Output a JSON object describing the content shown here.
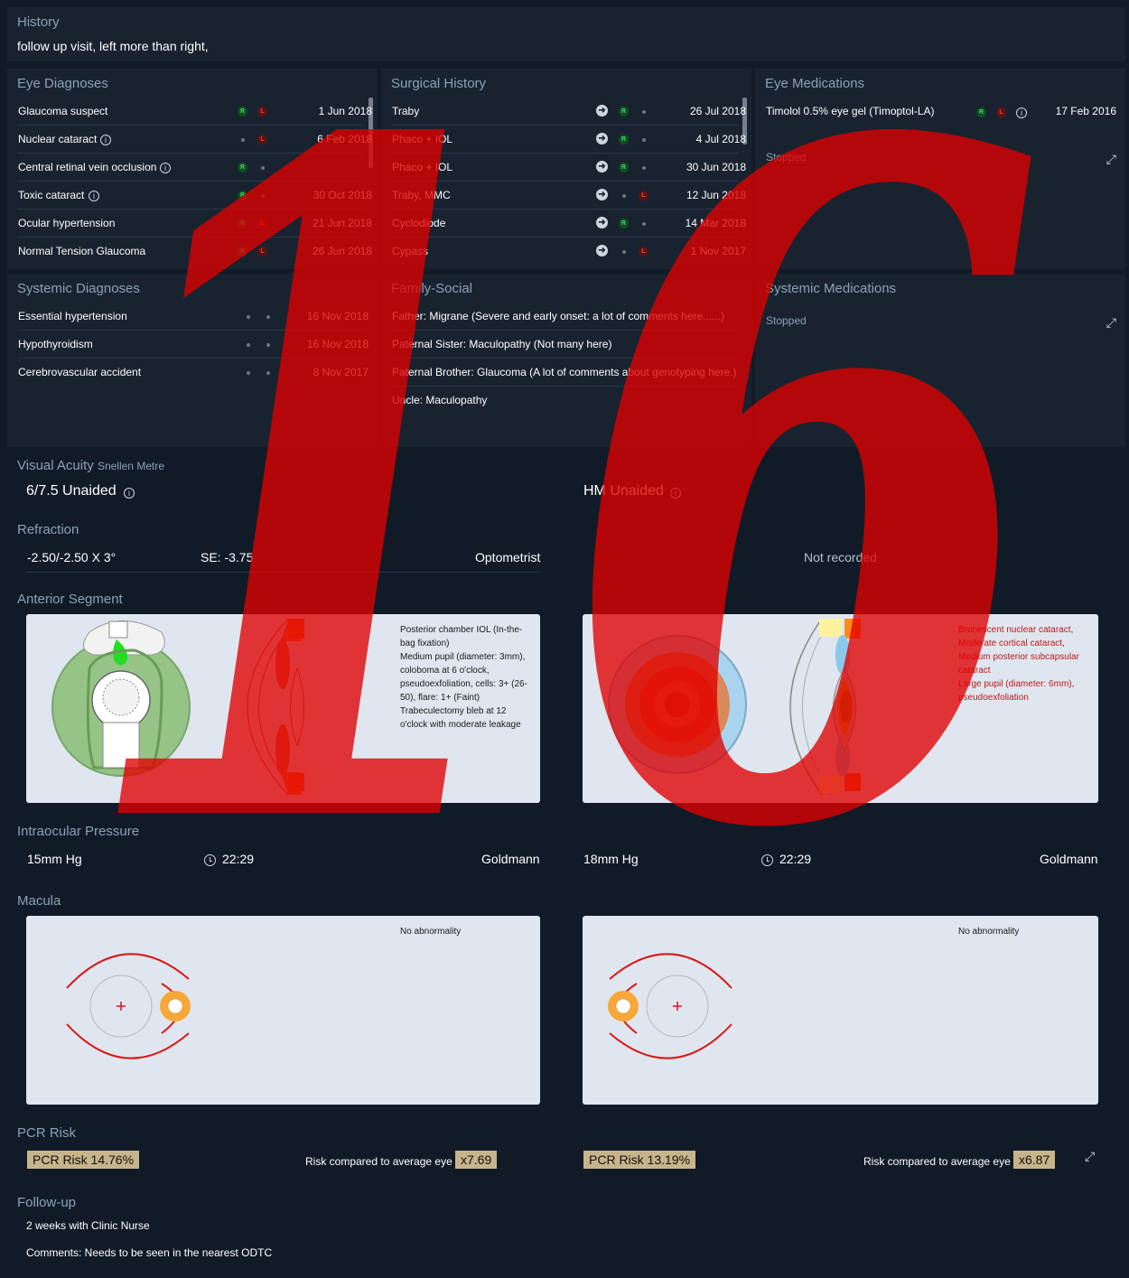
{
  "history": {
    "title": "History",
    "text": "follow up visit, left more than right,"
  },
  "eye_diagnoses": {
    "title": "Eye Diagnoses",
    "items": [
      {
        "label": "Glaucoma suspect",
        "date": "1 Jun 2018",
        "info": false
      },
      {
        "label": "Nuclear cataract",
        "date": "6 Feb 2018",
        "info": true
      },
      {
        "label": "Central retinal vein occlusion",
        "date": "",
        "info": true
      },
      {
        "label": "Toxic cataract",
        "date": "30 Oct 2018",
        "info": true
      },
      {
        "label": "Ocular hypertension",
        "date": "21 Jun 2018",
        "info": false
      },
      {
        "label": "Normal Tension Glaucoma",
        "date": "26 Jun 2018",
        "info": false
      }
    ]
  },
  "surgical_history": {
    "title": "Surgical History",
    "items": [
      {
        "label": "Traby",
        "date": "26 Jul 2018"
      },
      {
        "label": "Phaco + IOL",
        "date": "4 Jul 2018"
      },
      {
        "label": "Phaco + IOL",
        "date": "30 Jun 2018"
      },
      {
        "label": "Traby, MMC",
        "date": "12 Jun 2018"
      },
      {
        "label": "Cyclodiode",
        "date": "14 Mar 2018"
      },
      {
        "label": "Cypass",
        "date": "1 Nov 2017"
      }
    ]
  },
  "eye_medications": {
    "title": "Eye Medications",
    "item_label": "Timolol 0.5% eye gel (Timoptol-LA)",
    "item_date": "17 Feb 2016",
    "stopped_label": "Stopped"
  },
  "systemic_diagnoses": {
    "title": "Systemic Diagnoses",
    "items": [
      {
        "label": "Essential hypertension",
        "date": "16 Nov 2018"
      },
      {
        "label": "Hypothyroidism",
        "date": "16 Nov 2018"
      },
      {
        "label": "Cerebrovascular accident",
        "date": "8 Nov 2017"
      }
    ]
  },
  "family_social": {
    "title": "Family-Social",
    "items": [
      "Father: Migrane (Severe and early onset: a lot of comments here......)",
      "Paternal Sister: Maculopathy (Not many here)",
      "Paternal Brother: Glaucoma (A lot of comments about genotyping here.)",
      "Uncle: Maculopathy"
    ]
  },
  "systemic_medications": {
    "title": "Systemic Medications",
    "stopped_label": "Stopped"
  },
  "visual_acuity": {
    "title": "Visual Acuity",
    "subtitle": "Snellen Metre",
    "right": "6/7.5 Unaided",
    "left": "HM Unaided"
  },
  "refraction": {
    "title": "Refraction",
    "right_value": "-2.50/-2.50 X 3°",
    "right_se": "SE: -3.75",
    "right_source": "Optometrist",
    "left_value": "Not recorded"
  },
  "anterior_segment": {
    "title": "Anterior Segment",
    "right_notes": [
      "Posterior chamber IOL (In-the-",
      "bag fixation)",
      "Medium pupil (diameter: 3mm),",
      "coloboma at 6 o'clock,",
      "pseudoexfoliation, cells: 3+ (26-",
      "50), flare: 1+ (Faint)",
      "Trabeculectomy bleb at 12",
      "o'clock with moderate leakage"
    ],
    "left_notes": [
      "Brunescent nuclear cataract,",
      "Moderate cortical cataract,",
      "Medium posterior subcapsular",
      "cataract",
      "Large pupil (diameter: 6mm),",
      "pseudoexfoliation"
    ]
  },
  "iop": {
    "title": "Intraocular Pressure",
    "right_value": "15mm Hg",
    "right_time": "22:29",
    "right_method": "Goldmann",
    "left_value": "18mm Hg",
    "left_time": "22:29",
    "left_method": "Goldmann"
  },
  "macula": {
    "title": "Macula",
    "right_note": "No abnormality",
    "left_note": "No abnormality"
  },
  "pcr": {
    "title": "PCR Risk",
    "right_risk": "PCR Risk 14.76%",
    "right_compare_label": "Risk compared to average eye",
    "right_multiplier": "x7.69",
    "left_risk": "PCR Risk 13.19%",
    "left_compare_label": "Risk compared to average eye",
    "left_multiplier": "x6.87"
  },
  "followup": {
    "title": "Follow-up",
    "line1": "2 weeks with Clinic Nurse",
    "line2": "Comments: Needs to be seen in the nearest ODTC"
  },
  "watermark": "16",
  "colors": {
    "background": "#111b28",
    "panel": "#19232f",
    "section_title": "#8aa2b6",
    "right_badge": "#3ddc5a",
    "left_badge": "#ff3b3b",
    "pill": "#c8b48a",
    "watermark": "#e00000"
  },
  "icons": [
    "info-icon",
    "arrow-right-icon",
    "clock-icon",
    "expand-icon"
  ]
}
